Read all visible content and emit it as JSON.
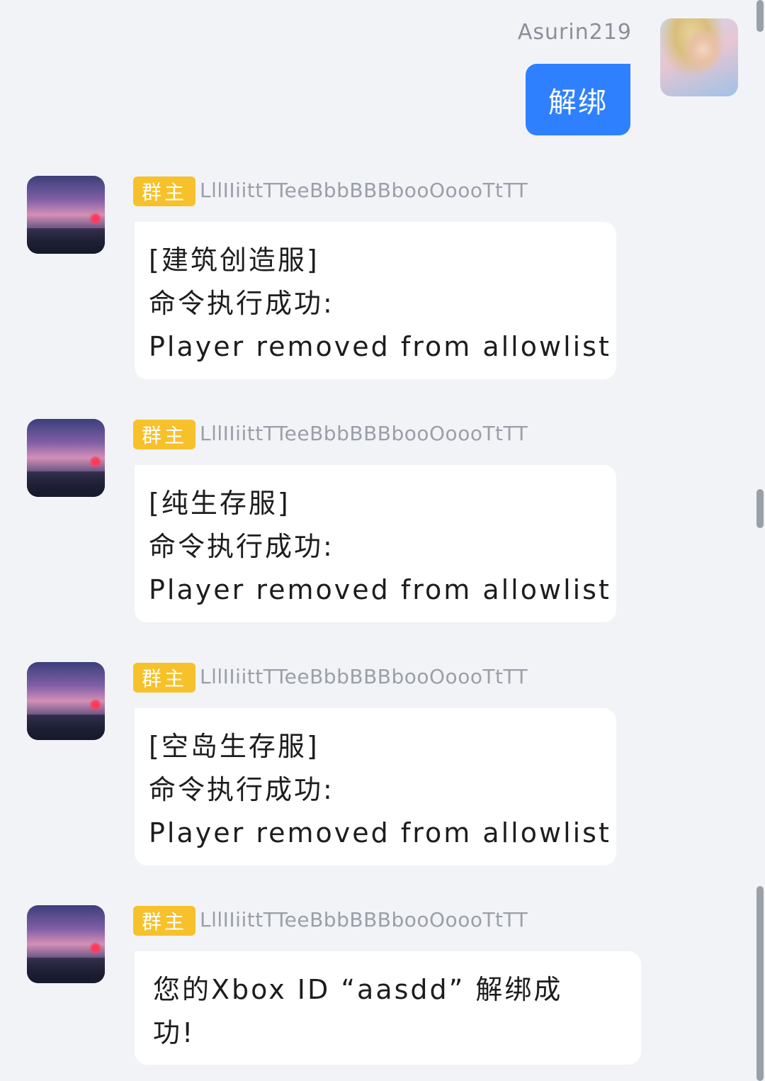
{
  "sent": {
    "name": "Asurin219",
    "text": "解绑"
  },
  "bot": {
    "badge": "群主",
    "name": "LllIIiittTTeeBbbBBBbooOoooTtTT"
  },
  "messages": [
    {
      "lines": [
        "[建筑创造服]",
        "命令执行成功:",
        "Player removed from allowlist"
      ]
    },
    {
      "lines": [
        "[纯生存服]",
        "命令执行成功:",
        "Player removed from allowlist"
      ]
    },
    {
      "lines": [
        "[空岛生存服]",
        "命令执行成功:",
        "Player removed from allowlist"
      ]
    },
    {
      "lines": [
        "您的Xbox ID “aasdd” 解绑成",
        "功!"
      ]
    }
  ]
}
